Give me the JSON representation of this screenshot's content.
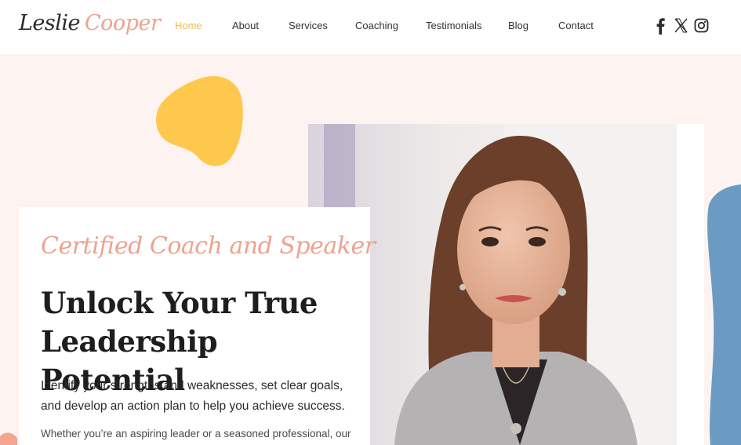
{
  "brand": {
    "first": "Leslie",
    "last": "Cooper"
  },
  "nav": {
    "items": [
      {
        "label": "Home",
        "active": true
      },
      {
        "label": "About"
      },
      {
        "label": "Services"
      },
      {
        "label": "Coaching"
      },
      {
        "label": "Testimonials"
      },
      {
        "label": "Blog"
      },
      {
        "label": "Contact"
      }
    ],
    "active_color": "#f2bf52"
  },
  "social": {
    "icons": [
      "facebook-icon",
      "x-icon",
      "instagram-icon"
    ]
  },
  "hero": {
    "tagline": "Certified Coach and Speaker",
    "headline_line1": "Unlock Your True",
    "headline_line2": "Leadership Potential",
    "lede": "Identify your strengths and weaknesses, set clear goals, and develop an action plan to help you achieve success.",
    "body": "Whether you’re an aspiring leader or a seasoned professional, our"
  },
  "colors": {
    "page_background": "#fdf3f0",
    "accent_pink": "#efa28f",
    "accent_yellow": "#fec84d",
    "accent_blue": "#6b9bc3"
  }
}
